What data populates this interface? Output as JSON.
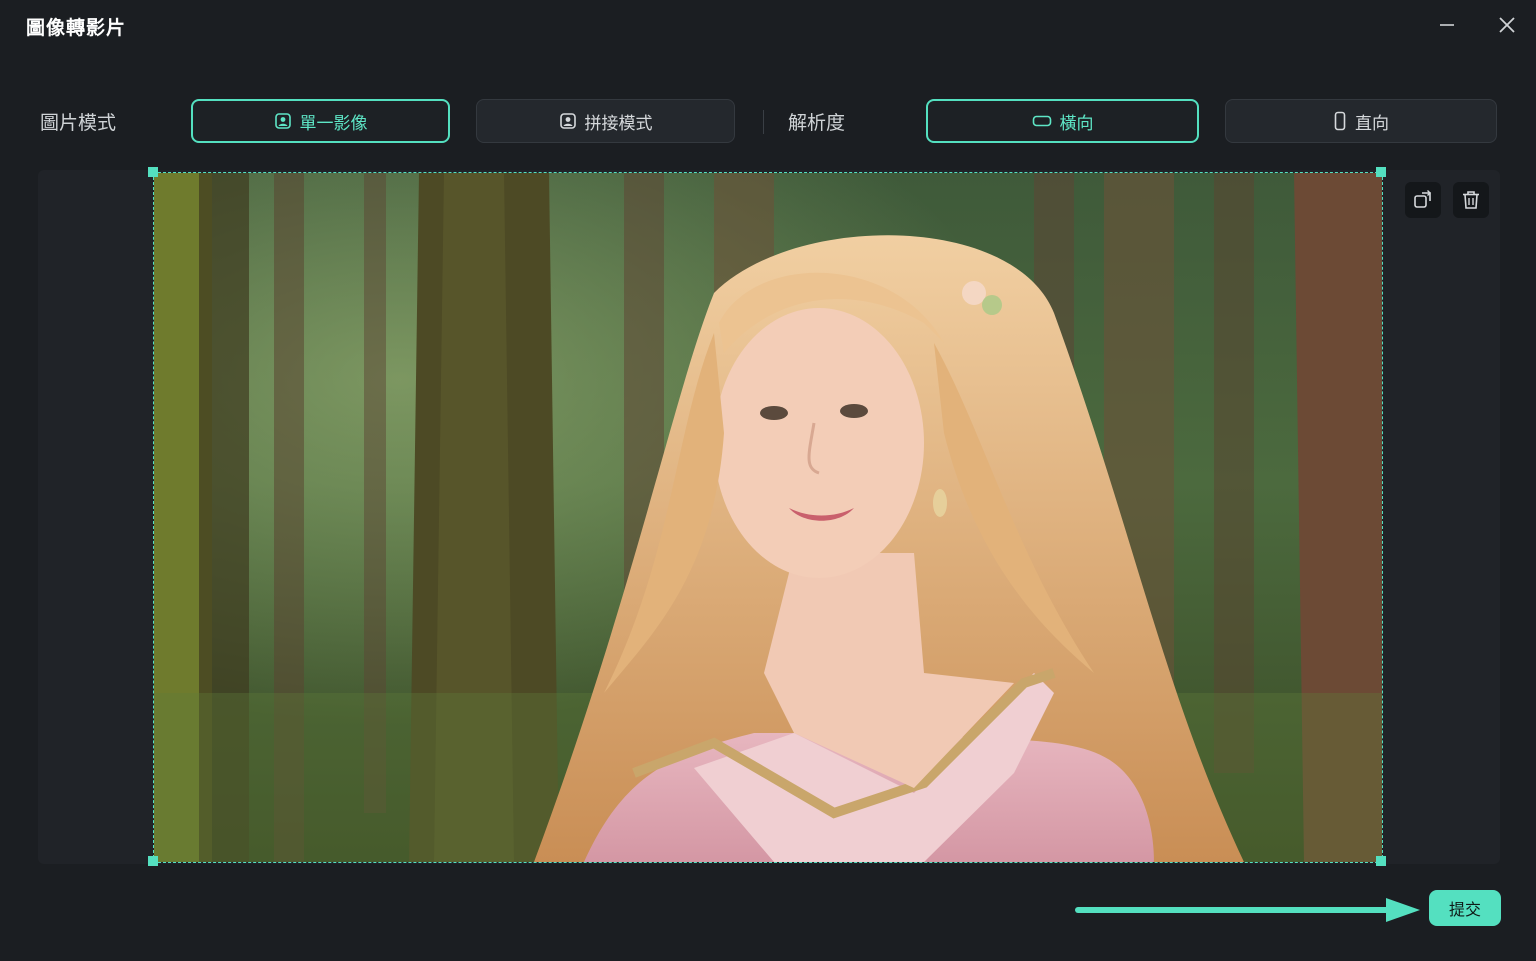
{
  "window": {
    "title": "圖像轉影片",
    "minimize_icon": "minimize-icon",
    "close_icon": "close-icon"
  },
  "image_mode": {
    "label": "圖片模式",
    "options": [
      {
        "label": "單一影像",
        "icon": "portrait-image-icon",
        "selected": true
      },
      {
        "label": "拼接模式",
        "icon": "portrait-image-icon",
        "selected": false
      }
    ]
  },
  "resolution": {
    "label": "解析度",
    "options": [
      {
        "label": "橫向",
        "icon": "landscape-icon",
        "selected": true
      },
      {
        "label": "直向",
        "icon": "portrait-icon",
        "selected": false
      }
    ]
  },
  "canvas": {
    "image_description": "photo of a woman with long wavy blonde hair in a pink gown standing in a sunlit forest",
    "tools": [
      {
        "name": "replace-image",
        "icon": "replace-icon"
      },
      {
        "name": "delete-image",
        "icon": "trash-icon"
      }
    ]
  },
  "footer": {
    "submit_label": "提交",
    "accent_color": "#54e0c0"
  }
}
